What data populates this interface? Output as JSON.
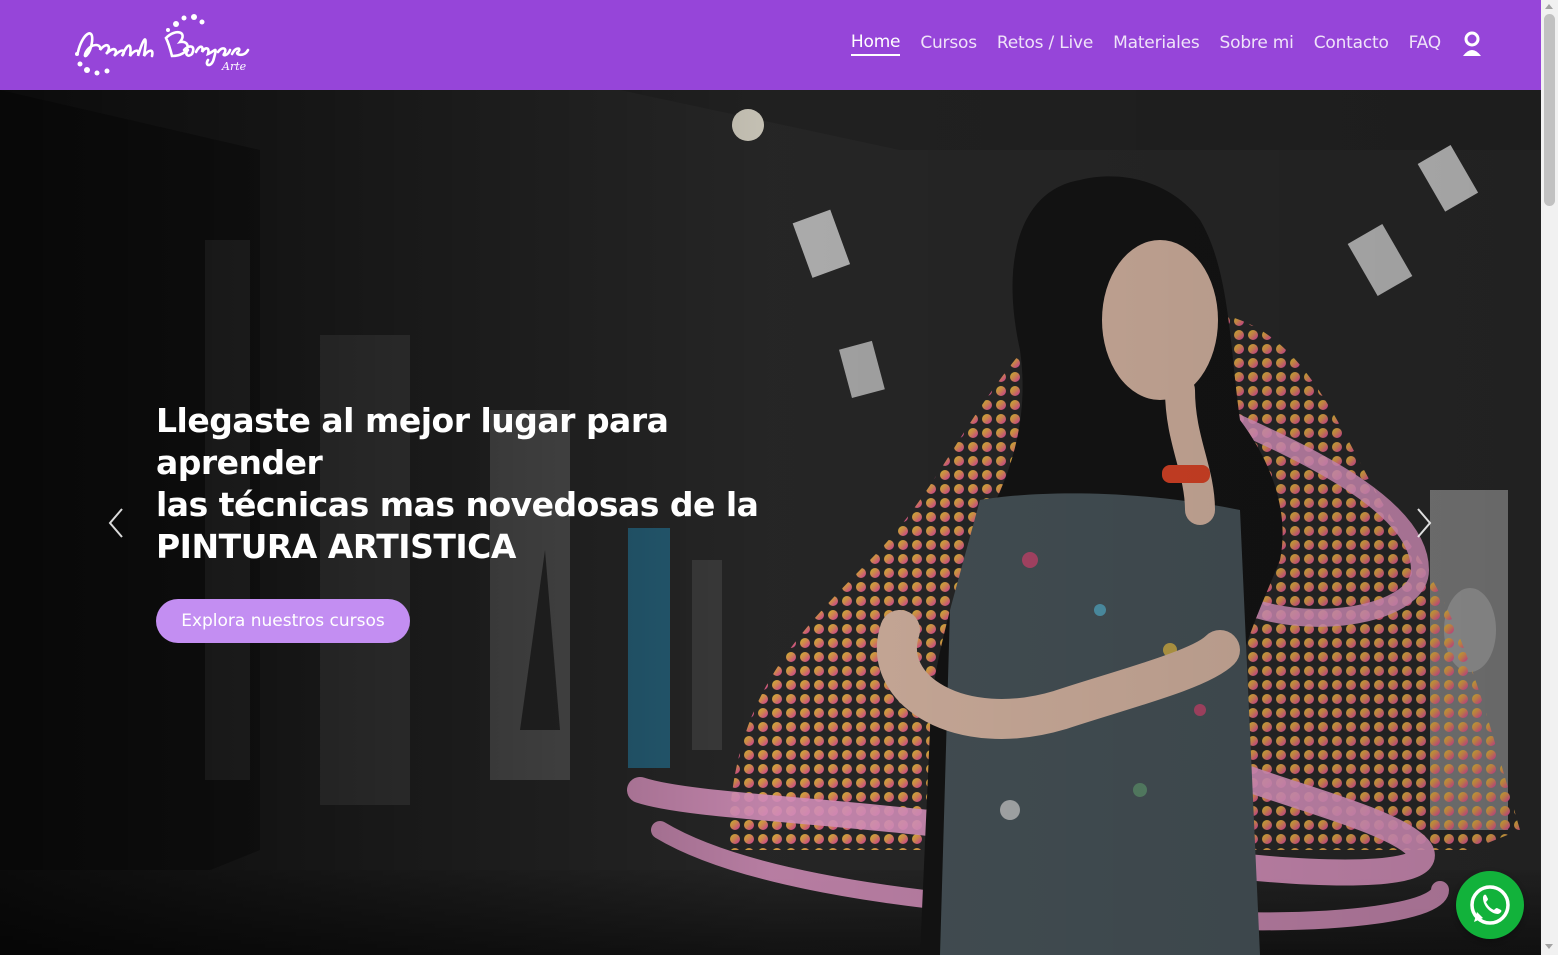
{
  "brand": {
    "logo_text": "Leewith Borges",
    "logo_subtext": "Arte",
    "nav_color": "#9645d9"
  },
  "nav": {
    "items": [
      {
        "label": "Home",
        "active": true
      },
      {
        "label": "Cursos"
      },
      {
        "label": "Retos / Live"
      },
      {
        "label": "Materiales"
      },
      {
        "label": "Sobre mi"
      },
      {
        "label": "Contacto"
      },
      {
        "label": "FAQ"
      }
    ],
    "user_icon": "user-icon"
  },
  "hero": {
    "headline_line1": "Llegaste al mejor lugar para aprender",
    "headline_line2": "las técnicas mas novedosas de la",
    "headline_line3": "PINTURA ARTISTICA",
    "cta_label": "Explora nuestros cursos",
    "cta_color": "#c38ef2",
    "prev_icon": "chevron-left-icon",
    "next_icon": "chevron-right-icon"
  },
  "floating": {
    "whatsapp_icon": "whatsapp-icon",
    "whatsapp_color": "#12b23b"
  }
}
